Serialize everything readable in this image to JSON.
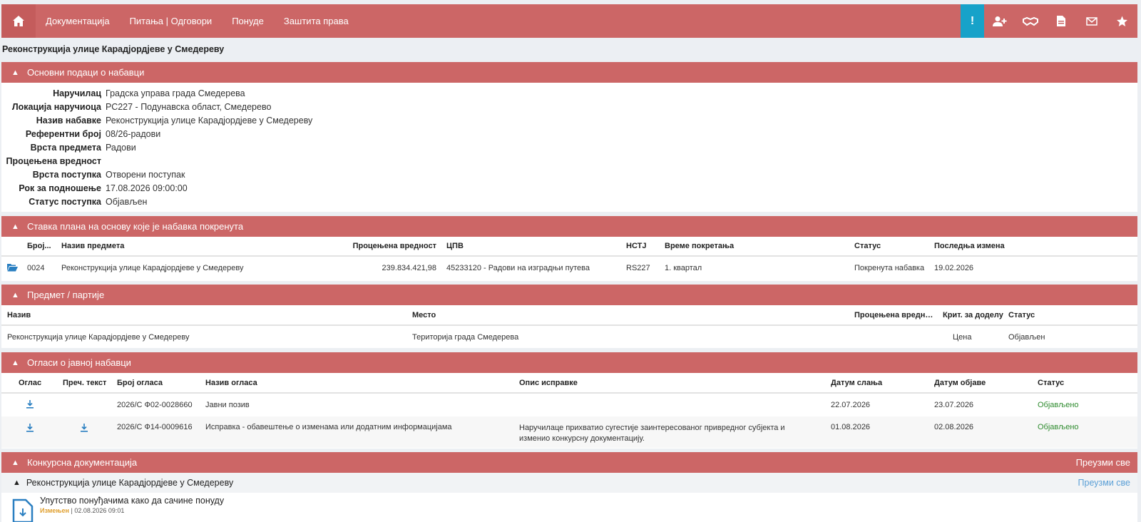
{
  "nav": {
    "links": [
      "Документација",
      "Питања | Одговори",
      "Понуде",
      "Заштита права"
    ],
    "alert_icon": "!"
  },
  "page_title": "Реконструкција улице Карадјордјеве у Смедереву",
  "basic": {
    "title": "Основни подаци о набавци",
    "rows": [
      {
        "label": "Наручилац",
        "value": "Градска управа града Смедерева"
      },
      {
        "label": "Локација наручиоца",
        "value": "РС227 - Подунавска област, Смедерево"
      },
      {
        "label": "Назив набавке",
        "value": "Реконструкција улице Карадјордјеве у Смедереву"
      },
      {
        "label": "Референтни број",
        "value": "08/26-радови"
      },
      {
        "label": "Врста предмета",
        "value": "Радови"
      },
      {
        "label": "Процењена вредност",
        "value": ""
      },
      {
        "label": "Врста поступка",
        "value": "Отворени поступак"
      },
      {
        "label": "Рок за подношење",
        "value": "17.08.2026 09:00:00"
      },
      {
        "label": "Статус поступка",
        "value": "Објављен"
      }
    ]
  },
  "plan": {
    "title": "Ставка плана на основу које је набавка покренута",
    "headers": [
      "Број...",
      "Назив предмета",
      "Процењена вредност",
      "ЦПВ",
      "НСТЈ",
      "Време покретања",
      "Статус",
      "Последња измена"
    ],
    "row": [
      "0024",
      "Реконструкција улице Карадјордјеве у Смедереву",
      "239.834.421,98",
      "45233120 - Радови на изградњи путева",
      "RS227",
      "1. квартал",
      "Покренута набавка",
      "19.02.2026"
    ]
  },
  "lots": {
    "title": "Предмет / партије",
    "headers": [
      "Назив",
      "Место",
      "Процењена вредност",
      "Крит. за доделу",
      "Статус"
    ],
    "row": [
      "Реконструкција улице Карадјордјеве у Смедереву",
      "Територија града Смедерева",
      "",
      "Цена",
      "Објављен"
    ]
  },
  "ads": {
    "title": "Огласи о јавној набавци",
    "headers": [
      "Оглас",
      "Преч. текст",
      "Број огласа",
      "Назив огласа",
      "Опис исправке",
      "Датум слања",
      "Датум објаве",
      "Статус"
    ],
    "rows": [
      {
        "num": "2026/С Ф02-0028660",
        "name": "Јавни позив",
        "desc1": "",
        "desc2": "",
        "sent": "22.07.2026",
        "pub": "23.07.2026",
        "status": "Објављено"
      },
      {
        "num": "2026/С Ф14-0009616",
        "name": "Исправка - обавештење о изменама или додатним информацијама",
        "desc1": "Наручилаце  прихватио сугестије заинтересованог привредног субјекта и",
        "desc2": "изменио конкурсну документацију.",
        "sent": "01.08.2026",
        "pub": "02.08.2026",
        "status": "Објављено"
      }
    ]
  },
  "docs": {
    "title": "Конкурсна документација",
    "download_all": "Преузми све",
    "sub_title": "Реконструкција улице Карадјордјеве у Смедереву",
    "sub_download_all": "Преузми све",
    "file_name": "Упутство понуђачима како да сачине понуду",
    "file_meta_tag": "Измењен",
    "file_meta": "| 02.08.2026 09:01"
  },
  "colors": {
    "brand": "#cc6666",
    "alert": "#17a2c9",
    "ok": "#2e8b2e"
  }
}
